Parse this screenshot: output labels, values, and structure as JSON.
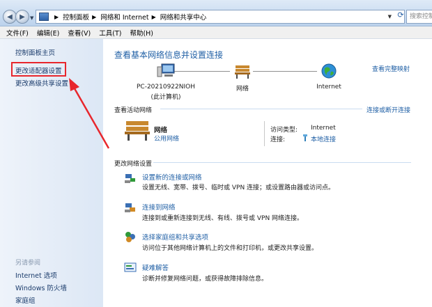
{
  "addressbar": {
    "breadcrumbs": [
      "控制面板",
      "网络和 Internet",
      "网络和共享中心"
    ],
    "search_placeholder": "搜索控制"
  },
  "menubar": {
    "items": [
      "文件(F)",
      "编辑(E)",
      "查看(V)",
      "工具(T)",
      "帮助(H)"
    ]
  },
  "sidebar": {
    "items": [
      {
        "label": "控制面板主页"
      },
      {
        "label": "更改适配器设置"
      },
      {
        "label": "更改高级共享设置"
      }
    ],
    "see_also_title": "另请参阅",
    "see_also": [
      {
        "label": "Internet 选项"
      },
      {
        "label": "Windows 防火墙"
      },
      {
        "label": "家庭组"
      }
    ]
  },
  "main": {
    "heading": "查看基本网络信息并设置连接",
    "full_map_link": "查看完整映射",
    "map": {
      "computer_name": "PC-20210922NIOH",
      "computer_sub": "(此计算机)",
      "network": "网络",
      "internet": "Internet"
    },
    "active": {
      "title": "查看活动网络",
      "connect_link": "连接或断开连接",
      "network_name": "网络",
      "network_type": "公用网络",
      "access_label": "访问类型:",
      "access_value": "Internet",
      "conn_label": "连接:",
      "conn_value": "本地连接"
    },
    "change": {
      "title": "更改网络设置",
      "tasks": [
        {
          "title": "设置新的连接或网络",
          "desc": "设置无线、宽带、拨号、临时或 VPN 连接；或设置路由器或访问点。"
        },
        {
          "title": "连接到网络",
          "desc": "连接到或重新连接到无线、有线、拨号或 VPN 网络连接。"
        },
        {
          "title": "选择家庭组和共享选项",
          "desc": "访问位于其他网络计算机上的文件和打印机，或更改共享设置。"
        },
        {
          "title": "疑难解答",
          "desc": "诊断并修复网络问题，或获得故障排除信息。"
        }
      ]
    }
  },
  "colors": {
    "link": "#1f5fa5",
    "annotation_red": "#e8262c"
  }
}
